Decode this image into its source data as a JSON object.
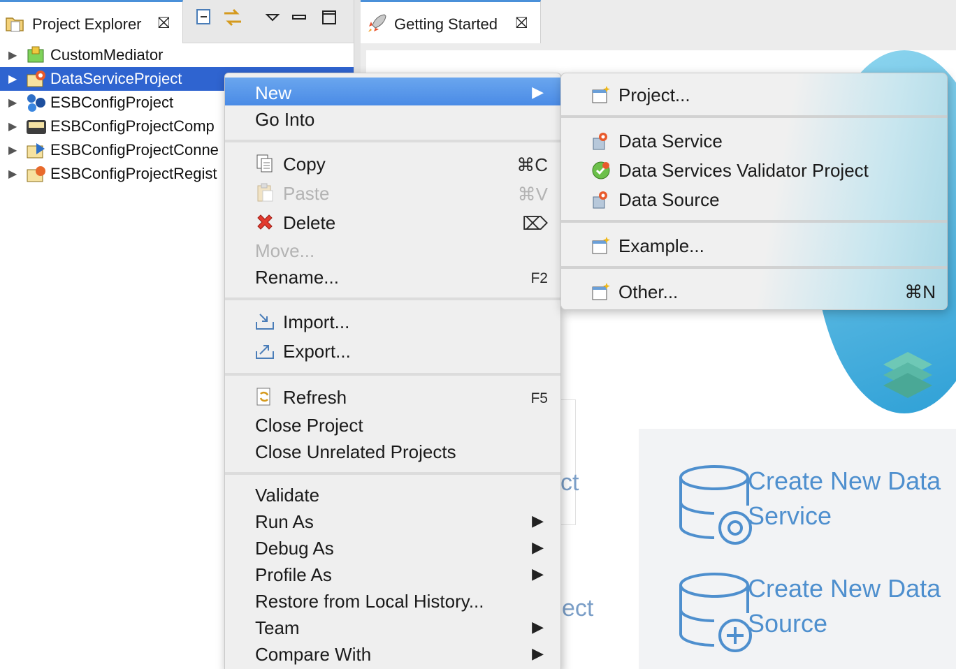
{
  "explorer": {
    "tab_title": "Project Explorer",
    "close_glyph": "⛝",
    "items": [
      {
        "label": "CustomMediator",
        "icon": "mediator-project-icon"
      },
      {
        "label": "DataServiceProject",
        "icon": "data-service-project-icon",
        "selected": true
      },
      {
        "label": "ESBConfigProject",
        "icon": "esb-config-project-icon"
      },
      {
        "label": "ESBConfigProjectComp",
        "icon": "composite-project-icon"
      },
      {
        "label": "ESBConfigProjectConne",
        "icon": "connector-project-icon"
      },
      {
        "label": "ESBConfigProjectRegist",
        "icon": "registry-project-icon"
      }
    ]
  },
  "editor": {
    "tab_title": "Getting Started",
    "close_glyph": "⛝",
    "partial_text_1": "ct",
    "partial_text_2": "ect",
    "cards": [
      {
        "line1": "Create New Data",
        "line2": "Service",
        "icon": "database-gear-icon"
      },
      {
        "line1": "Create New Data",
        "line2": "Source",
        "icon": "database-plus-icon"
      }
    ]
  },
  "context_menu": {
    "new": "New",
    "go_into": "Go Into",
    "copy": "Copy",
    "copy_shortcut": "⌘C",
    "paste": "Paste",
    "paste_shortcut": "⌘V",
    "delete": "Delete",
    "delete_shortcut": "⌦",
    "move": "Move...",
    "rename": "Rename...",
    "rename_shortcut": "F2",
    "import": "Import...",
    "export": "Export...",
    "refresh": "Refresh",
    "refresh_shortcut": "F5",
    "close_project": "Close Project",
    "close_unrelated": "Close Unrelated Projects",
    "validate": "Validate",
    "run_as": "Run As",
    "debug_as": "Debug As",
    "profile_as": "Profile As",
    "restore": "Restore from Local History...",
    "team": "Team",
    "compare_with": "Compare With",
    "arrow": "▶"
  },
  "submenu": {
    "project": "Project...",
    "data_service": "Data Service",
    "validator_project": "Data Services Validator Project",
    "data_source": "Data Source",
    "example": "Example...",
    "other": "Other...",
    "other_shortcut": "⌘N"
  }
}
